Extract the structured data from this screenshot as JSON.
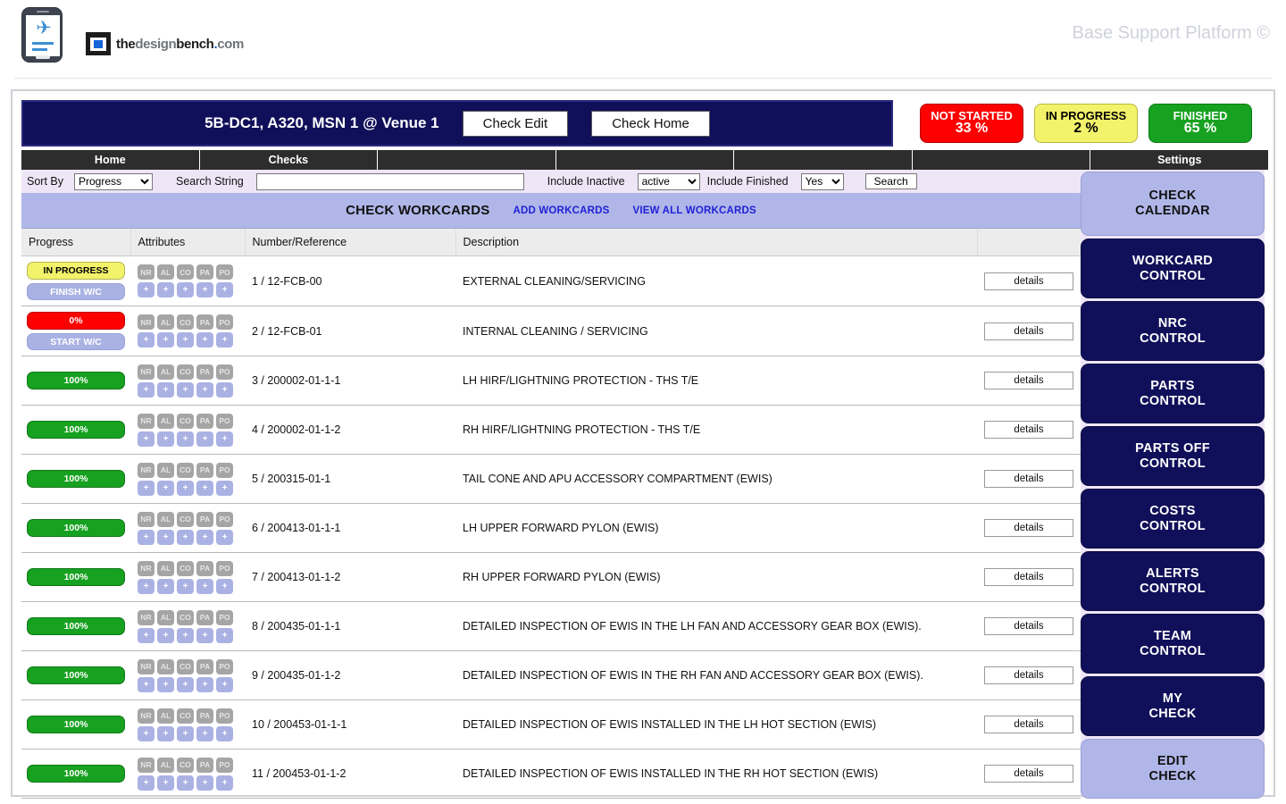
{
  "brand": {
    "logo_wordmark_the": "the",
    "logo_wordmark_design": "design",
    "logo_wordmark_bench": "bench",
    "logo_wordmark_dot": ".",
    "logo_wordmark_com": "com",
    "platform_tag": "Base Support Platform ©",
    "plane_glyph": "✈"
  },
  "titlebar": {
    "check_title": "5B-DC1, A320, MSN 1 @ Venue 1",
    "check_edit_label": "Check Edit",
    "check_home_label": "Check Home"
  },
  "status_pills": [
    {
      "label": "NOT STARTED",
      "value": "33 %",
      "color": "#fe0000"
    },
    {
      "label": "IN PROGRESS",
      "value": "2 %",
      "color": "#f3f36b"
    },
    {
      "label": "FINISHED",
      "value": "65 %",
      "color": "#17a120"
    }
  ],
  "navtabs": [
    {
      "label": "Home"
    },
    {
      "label": "Checks"
    },
    {
      "label": ""
    },
    {
      "label": ""
    },
    {
      "label": ""
    },
    {
      "label": ""
    },
    {
      "label": "Settings"
    }
  ],
  "searchbar": {
    "sort_by_label": "Sort By",
    "sort_by_value": "Progress",
    "sort_by_options": [
      "Progress"
    ],
    "search_string_label": "Search String",
    "search_string_value": "",
    "search_string_placeholder": "",
    "include_inactive_label": "Include Inactive",
    "include_inactive_value": "active",
    "include_inactive_options": [
      "active"
    ],
    "include_finished_label": "Include Finished",
    "include_finished_value": "Yes",
    "include_finished_options": [
      "Yes"
    ],
    "search_button_label": "Search"
  },
  "section": {
    "title": "CHECK WORKCARDS",
    "add_link": "ADD WORKCARDS",
    "view_all_link": "VIEW ALL WORKCARDS"
  },
  "table": {
    "columns": [
      "Progress",
      "Attributes",
      "Number/Reference",
      "Description",
      ""
    ],
    "attribute_tags": [
      "NR",
      "AL",
      "CO",
      "PA",
      "PO"
    ],
    "add_glyph": "+",
    "details_label": "details",
    "rows": [
      {
        "progress_label": "IN PROGRESS",
        "progress_state": "yellow",
        "action_label": "FINISH W/C",
        "number": "1 / 12-FCB-00",
        "description": "EXTERNAL CLEANING/SERVICING"
      },
      {
        "progress_label": "0%",
        "progress_state": "red",
        "action_label": "START W/C",
        "number": "2 / 12-FCB-01",
        "description": "INTERNAL CLEANING / SERVICING"
      },
      {
        "progress_label": "100%",
        "progress_state": "green",
        "action_label": "",
        "number": "3 / 200002-01-1-1",
        "description": "LH HIRF/LIGHTNING PROTECTION - THS T/E"
      },
      {
        "progress_label": "100%",
        "progress_state": "green",
        "action_label": "",
        "number": "4 / 200002-01-1-2",
        "description": "RH HIRF/LIGHTNING PROTECTION - THS T/E"
      },
      {
        "progress_label": "100%",
        "progress_state": "green",
        "action_label": "",
        "number": "5 / 200315-01-1",
        "description": "TAIL CONE AND APU ACCESSORY COMPARTMENT (EWIS)"
      },
      {
        "progress_label": "100%",
        "progress_state": "green",
        "action_label": "",
        "number": "6 / 200413-01-1-1",
        "description": "LH UPPER FORWARD PYLON (EWIS)"
      },
      {
        "progress_label": "100%",
        "progress_state": "green",
        "action_label": "",
        "number": "7 / 200413-01-1-2",
        "description": "RH UPPER FORWARD PYLON (EWIS)"
      },
      {
        "progress_label": "100%",
        "progress_state": "green",
        "action_label": "",
        "number": "8 / 200435-01-1-1",
        "description": "DETAILED INSPECTION OF EWIS IN THE LH FAN AND ACCESSORY GEAR BOX (EWIS)."
      },
      {
        "progress_label": "100%",
        "progress_state": "green",
        "action_label": "",
        "number": "9 / 200435-01-1-2",
        "description": "DETAILED INSPECTION OF EWIS IN THE RH FAN AND ACCESSORY GEAR BOX (EWIS)."
      },
      {
        "progress_label": "100%",
        "progress_state": "green",
        "action_label": "",
        "number": "10 / 200453-01-1-1",
        "description": "DETAILED INSPECTION OF EWIS INSTALLED IN THE LH HOT SECTION (EWIS)"
      },
      {
        "progress_label": "100%",
        "progress_state": "green",
        "action_label": "",
        "number": "11 / 200453-01-1-2",
        "description": "DETAILED INSPECTION OF EWIS INSTALLED IN THE RH HOT SECTION (EWIS)"
      }
    ]
  },
  "sidebar": {
    "items": [
      {
        "label": "CHECK\nCALENDAR",
        "style": "light"
      },
      {
        "label": "WORKCARD\nCONTROL",
        "style": "dark"
      },
      {
        "label": "NRC\nCONTROL",
        "style": "dark"
      },
      {
        "label": "PARTS\nCONTROL",
        "style": "dark"
      },
      {
        "label": "PARTS OFF\nCONTROL",
        "style": "dark"
      },
      {
        "label": "COSTS\nCONTROL",
        "style": "dark"
      },
      {
        "label": "ALERTS\nCONTROL",
        "style": "dark"
      },
      {
        "label": "TEAM\nCONTROL",
        "style": "dark"
      },
      {
        "label": "MY\nCHECK",
        "style": "dark"
      },
      {
        "label": "EDIT\nCHECK",
        "style": "light"
      }
    ]
  }
}
